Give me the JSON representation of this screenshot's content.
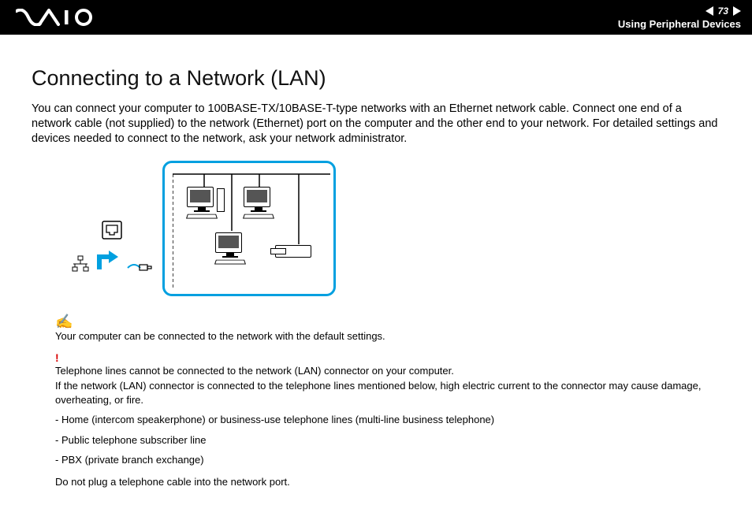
{
  "header": {
    "page_number": "73",
    "section": "Using Peripheral Devices"
  },
  "title": "Connecting to a Network (LAN)",
  "intro": "You can connect your computer to 100BASE-TX/10BASE-T-type networks with an Ethernet network cable. Connect one end of a network cable (not supplied) to the network (Ethernet) port on the computer and the other end to your network. For detailed settings and devices needed to connect to the network, ask your network administrator.",
  "note": "Your computer can be connected to the network with the default settings.",
  "warning": {
    "line1": "Telephone lines cannot be connected to the network (LAN) connector on your computer.",
    "line2": "If the network (LAN) connector is connected to the telephone lines mentioned below, high electric current to the connector may cause damage, overheating, or fire.",
    "bullets": [
      "- Home (intercom speakerphone) or business-use telephone lines (multi-line business telephone)",
      "- Public telephone subscriber line",
      "- PBX (private branch exchange)"
    ],
    "final": "Do not plug a telephone cable into the network port."
  }
}
